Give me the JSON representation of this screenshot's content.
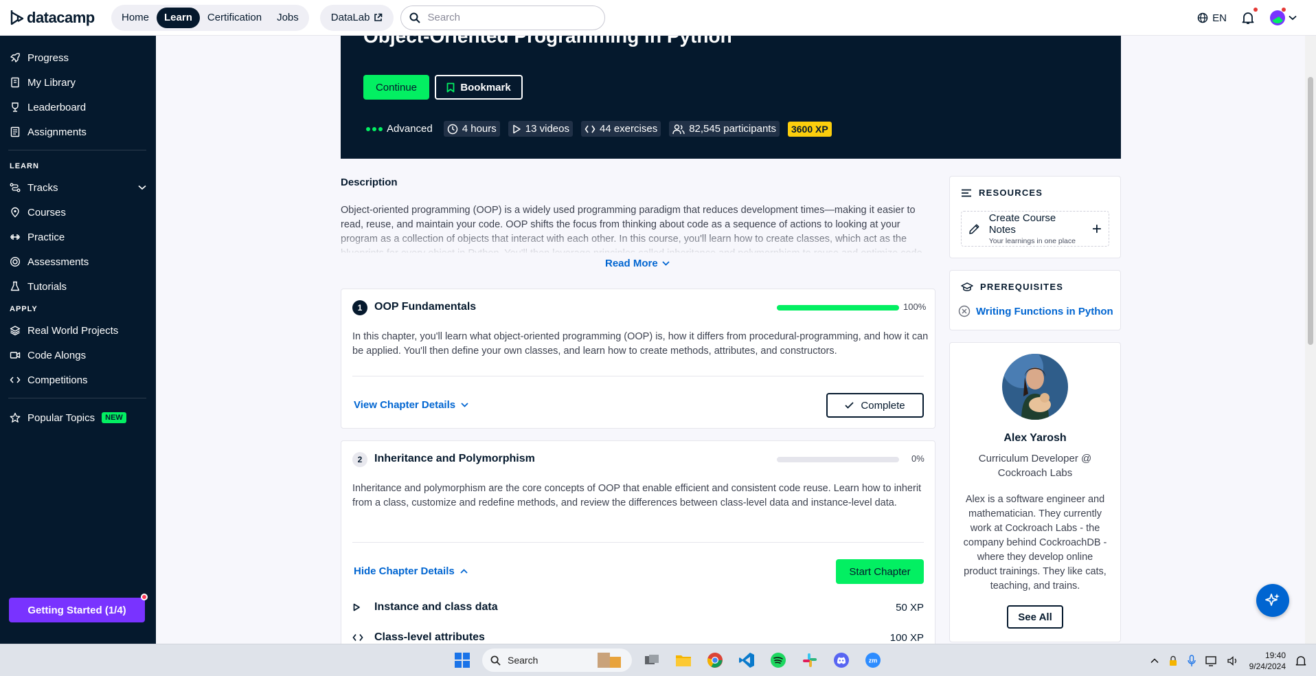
{
  "topbar": {
    "logo_text": "datacamp",
    "nav": [
      "Home",
      "Learn",
      "Certification",
      "Jobs"
    ],
    "active_nav": "Learn",
    "datalab_label": "DataLab",
    "search_placeholder": "Search",
    "language": "EN"
  },
  "sidebar": {
    "top_items": [
      "Progress",
      "My Library",
      "Leaderboard",
      "Assignments"
    ],
    "learn_heading": "LEARN",
    "learn_items": [
      "Tracks",
      "Courses",
      "Practice",
      "Assessments",
      "Tutorials"
    ],
    "apply_heading": "APPLY",
    "apply_items": [
      "Real World Projects",
      "Code Alongs",
      "Competitions"
    ],
    "popular_topics": "Popular Topics",
    "new_badge": "NEW",
    "getting_started": "Getting Started (1/4)"
  },
  "course": {
    "title": "Object-Oriented Programming in Python",
    "continue_label": "Continue",
    "bookmark_label": "Bookmark",
    "level": "Advanced",
    "duration": "4 hours",
    "videos": "13 videos",
    "exercises": "44 exercises",
    "participants": "82,545 participants",
    "xp": "3600 XP"
  },
  "description": {
    "title": "Description",
    "text": "Object-oriented programming (OOP) is a widely used programming paradigm that reduces development times—making it easier to read, reuse, and maintain your code. OOP shifts the focus from thinking about code as a sequence of actions to looking at your program as a collection of objects that interact with each other. In this course, you'll learn how to create classes, which act as the blueprints for every object in Python. You'll then leverage principles called inheritance and polymorphism to reuse and optimize code.",
    "read_more": "Read More"
  },
  "chapters": [
    {
      "number": "1",
      "title": "OOP Fundamentals",
      "progress_label": "100%",
      "progress": 1.0,
      "text": "In this chapter, you'll learn what object-oriented programming (OOP) is, how it differs from procedural-programming, and how it can be applied. You'll then define your own classes, and learn how to create methods, attributes, and constructors.",
      "details_link": "View Chapter Details",
      "action": "Complete"
    },
    {
      "number": "2",
      "title": "Inheritance and Polymorphism",
      "progress_label": "0%",
      "progress": 0.0,
      "text": "Inheritance and polymorphism are the core concepts of OOP that enable efficient and consistent code reuse. Learn how to inherit from a class, customize and redefine methods, and review the differences between class-level data and instance-level data.",
      "details_link": "Hide Chapter Details",
      "action": "Start Chapter",
      "exercises": [
        {
          "name": "Instance and class data",
          "xp": "50 XP",
          "icon": "play-icon"
        },
        {
          "name": "Class-level attributes",
          "xp": "100 XP",
          "icon": "code-icon"
        }
      ]
    }
  ],
  "resources": {
    "heading": "RESOURCES",
    "notes_title": "Create Course Notes",
    "notes_sub": "Your learnings in one place"
  },
  "prerequisites": {
    "heading": "PREREQUISITES",
    "course": "Writing Functions in Python"
  },
  "instructor": {
    "name": "Alex Yarosh",
    "role": "Curriculum Developer @ Cockroach Labs",
    "bio": "Alex is a software engineer and mathematician. They currently work at Cockroach Labs - the company behind CockroachDB - where they develop online product trainings. They like cats, teaching, and trains.",
    "see_all": "See All"
  },
  "taskbar": {
    "search_label": "Search",
    "time": "19:40",
    "date": "9/24/2024"
  },
  "colors": {
    "navy": "#05192d",
    "green": "#03ef62",
    "blue": "#0065d1",
    "purple": "#7933ff",
    "xp_yellow": "#fcce0d"
  }
}
